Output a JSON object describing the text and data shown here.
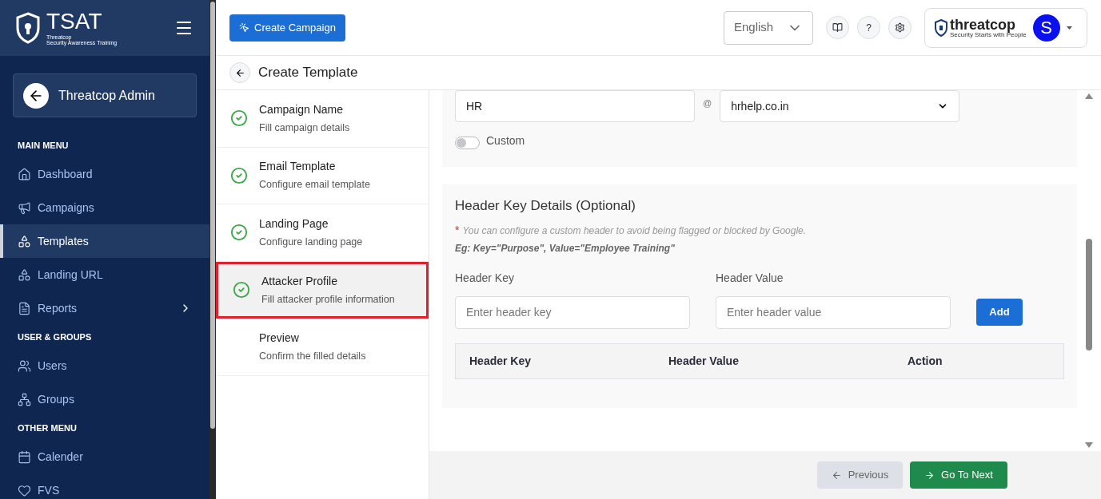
{
  "brand": {
    "name": "TSAT",
    "line_1": "Threatcop",
    "line_2": "Security Awareness Training"
  },
  "account_button": {
    "label": "Threatcop Admin"
  },
  "sidebar": {
    "sections": [
      {
        "title": "MAIN MENU",
        "items": [
          {
            "label": "Dashboard",
            "selected": false,
            "has_submenu": false
          },
          {
            "label": "Campaigns",
            "selected": false,
            "has_submenu": false
          },
          {
            "label": "Templates",
            "selected": true,
            "has_submenu": false
          },
          {
            "label": "Landing URL",
            "selected": false,
            "has_submenu": false
          },
          {
            "label": "Reports",
            "selected": false,
            "has_submenu": true
          }
        ]
      },
      {
        "title": "USER & GROUPS",
        "items": [
          {
            "label": "Users",
            "selected": false,
            "has_submenu": false
          },
          {
            "label": "Groups",
            "selected": false,
            "has_submenu": false
          }
        ]
      },
      {
        "title": "OTHER MENU",
        "items": [
          {
            "label": "Calender",
            "selected": false,
            "has_submenu": false
          },
          {
            "label": "FVS",
            "selected": false,
            "has_submenu": false
          }
        ]
      }
    ]
  },
  "topbar": {
    "create_button": "Create Campaign",
    "language": "English",
    "help": "?",
    "company": {
      "name": "threatcop",
      "tagline": "Security Starts with People"
    },
    "avatar": "S"
  },
  "page": {
    "title": "Create Template"
  },
  "steps": [
    {
      "title": "Campaign Name",
      "subtitle": "Fill campaign details",
      "completed": true,
      "selected": false
    },
    {
      "title": "Email Template",
      "subtitle": "Configure email template",
      "completed": true,
      "selected": false
    },
    {
      "title": "Landing Page",
      "subtitle": "Configure landing page",
      "completed": true,
      "selected": false
    },
    {
      "title": "Attacker Profile",
      "subtitle": "Fill attacker profile information",
      "completed": true,
      "selected": true
    },
    {
      "title": "Preview",
      "subtitle": "Confirm the filled details",
      "completed": false,
      "selected": false
    }
  ],
  "sender": {
    "name": "HR",
    "at": "@",
    "domain": "hrhelp.co.in",
    "custom_label": "Custom",
    "custom_on": false
  },
  "header_details": {
    "title": "Header Key Details (Optional)",
    "asterisk": "*",
    "note": "You can configure a custom header to avoid being flagged or blocked by Google.",
    "example": "Eg: Key=\"Purpose\", Value=\"Employee Training\"",
    "key_label": "Header Key",
    "key_placeholder": "Enter header key",
    "value_label": "Header Value",
    "value_placeholder": "Enter header value",
    "add_button": "Add",
    "table_columns": [
      "Header Key",
      "Header Value",
      "Action"
    ]
  },
  "footer": {
    "previous": "Previous",
    "next": "Go To Next"
  }
}
